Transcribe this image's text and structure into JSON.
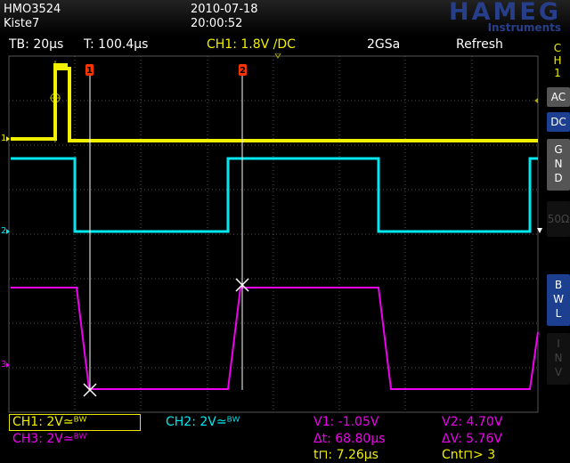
{
  "header": {
    "model": "HMO3524",
    "label": "Kiste7",
    "date": "2010-07-18",
    "time": "20:00:52",
    "brand": "HAMEG",
    "brand_sub": "Instruments"
  },
  "status": {
    "timebase": "TB: 20µs",
    "trigger_time": "T: 100.4µs",
    "trigger_ch": "CH1: 1.8V ∕DC",
    "sample_rate": "2GSa",
    "mode": "Refresh"
  },
  "side": {
    "channel": [
      "C",
      "H",
      "1"
    ],
    "ac": "AC",
    "dc": "DC",
    "gnd": [
      "G",
      "N",
      "D"
    ],
    "ohm": "50Ω",
    "bwl": [
      "B",
      "W",
      "L"
    ],
    "inv": [
      "I",
      "N",
      "V"
    ]
  },
  "markers": {
    "cursor1": "1",
    "cursor2": "2",
    "ch1": "1",
    "ch2": "2",
    "ch3": "3"
  },
  "bottom": {
    "ch1": "CH1: 2V≃ᴮᵂ",
    "ch2": "CH2: 2V≃ᴮᵂ",
    "ch3": "CH3: 2V≃ᴮᵂ",
    "v1": "V1: -1.05V",
    "v2": "V2: 4.70V",
    "dt": "Δt: 68.80µs",
    "dv": "ΔV: 5.76V",
    "tpulse": "t⊓: 7.26µs",
    "cnt": "Cnt⊓> 3"
  },
  "colors": {
    "ch1": "#f0f000",
    "ch2": "#00e8f0",
    "ch3": "#f000f0",
    "grid": "#555555",
    "active_button": "#1c3f8f"
  }
}
